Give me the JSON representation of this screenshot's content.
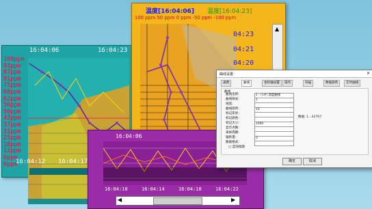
{
  "panel1": {
    "time_left": "16:04:06",
    "time_right": "16:04:23",
    "y_labels": [
      "100ppm",
      "93ppm",
      "87ppm",
      "81ppm",
      "75ppm",
      "68ppm",
      "62ppm",
      "56ppm",
      "50ppm",
      "43ppm",
      "37ppm",
      "31ppm",
      "25ppm",
      "18ppm",
      "12ppm",
      "6ppm",
      "0ppm"
    ],
    "bottom_left": "16:04:12",
    "bottom_right": "16:04:17"
  },
  "panel2": {
    "title_a": "温度[16:04:06]",
    "title_b": "温度[16:04:23]",
    "scale": "100 ppm   50 ppm   0 ppm -50 ppm -100 ppm",
    "times": [
      "04:23",
      "04:21",
      "04:20"
    ]
  },
  "panel3": {
    "header": "16:04:06",
    "ticks": [
      "16:04:10",
      "16:04:14",
      "16:04:18",
      "16:04:22"
    ]
  },
  "dialog": {
    "title": "曲线设置",
    "tabs": [
      "通用",
      "曲线",
      "坐标轴设置",
      "操作",
      "扫描",
      "数据颜色",
      "实时曲线"
    ],
    "section": "曲线",
    "labels": [
      "曲线名称:",
      "曲线样式:",
      "线宽:",
      "曲线颜色:",
      "标记形状:",
      "标记颜色:",
      "标记大小:",
      "显示点数:",
      "采样周期:",
      "偏移量:",
      "数据格式:"
    ],
    "values": [
      "1 - (1#) 温度曲线",
      "1",
      "",
      "10",
      "",
      "",
      "1000",
      "",
      "",
      "0",
      ""
    ],
    "note": "数据: 1...32767",
    "check_label": "□ 自动缩放",
    "ok": "确定",
    "cancel": "取消"
  }
}
